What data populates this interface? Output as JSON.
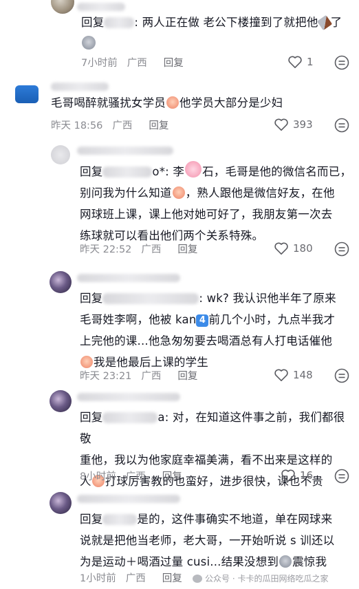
{
  "comments": [
    {
      "reply_prefix": "回复",
      "text": ": 两人正在做 老公下楼撞到了就把他",
      "text_tail": "了",
      "time": "7小时前",
      "location": "广西",
      "reply_label": "回复",
      "likes": "1"
    },
    {
      "text_a": "毛哥喝醉就骚扰女学员",
      "text_b": "他学员大部分是少妇",
      "time": "昨天 18:56",
      "location": "广西",
      "reply_label": "回复",
      "likes": "393"
    },
    {
      "reply_prefix": "回复",
      "line1": "o*: 李",
      "line1b": "石，毛哥是他的微信名而已，",
      "line2a": "别问我为什么知道",
      "line2b": "，熟人跟他是微信好友，在他",
      "line3": "网球班上课，课上他对她可好了，我朋友第一次去",
      "line4": "练球就可以看出他们两个关系特殊。",
      "time": "昨天 22:52",
      "location": "广西",
      "reply_label": "回复",
      "likes": "180"
    },
    {
      "reply_prefix": "回复",
      "line1": ": wk? 我认识他半年了原来",
      "line2a": "毛哥姓李啊，他被 kan",
      "badge": "4",
      "line2b": "前几个小时，九点半我才",
      "line3": "上完他的课...他急匆匆要去喝酒总有人打电话催他",
      "line4": "我是他最后上课的学生",
      "time": "昨天 23:21",
      "location": "广西",
      "reply_label": "回复",
      "likes": "148"
    },
    {
      "reply_prefix": "回复",
      "line1": "a: 对，在知道这件事之前，我们都很敬",
      "line2": "重他，我以为他家庭幸福美满，看不出来是这样的",
      "line3a": "人",
      "line3b": "打球厉害教的也蛮好，进步很快，课也不贵",
      "time": "8小时前",
      "location": "广西",
      "reply_label": "回复",
      "likes": "16"
    },
    {
      "reply_prefix": "回复",
      "line1": "是的，这件事确实不地道，单在网球来",
      "line2": "说就是把他当老师，老大哥，一开始听说 s 训还以",
      "line3a": "为是运动＋喝酒过量 cusi...结果没想到",
      "line3b": "震惊我",
      "time": "1小时前",
      "location": "广西",
      "reply_label": "回复"
    }
  ],
  "watermark": "公众号 · 卡卡的瓜田网络吃瓜之家",
  "colors": {
    "text": "#161823",
    "meta": "#8a8b91",
    "icon": "#5a5b61"
  }
}
